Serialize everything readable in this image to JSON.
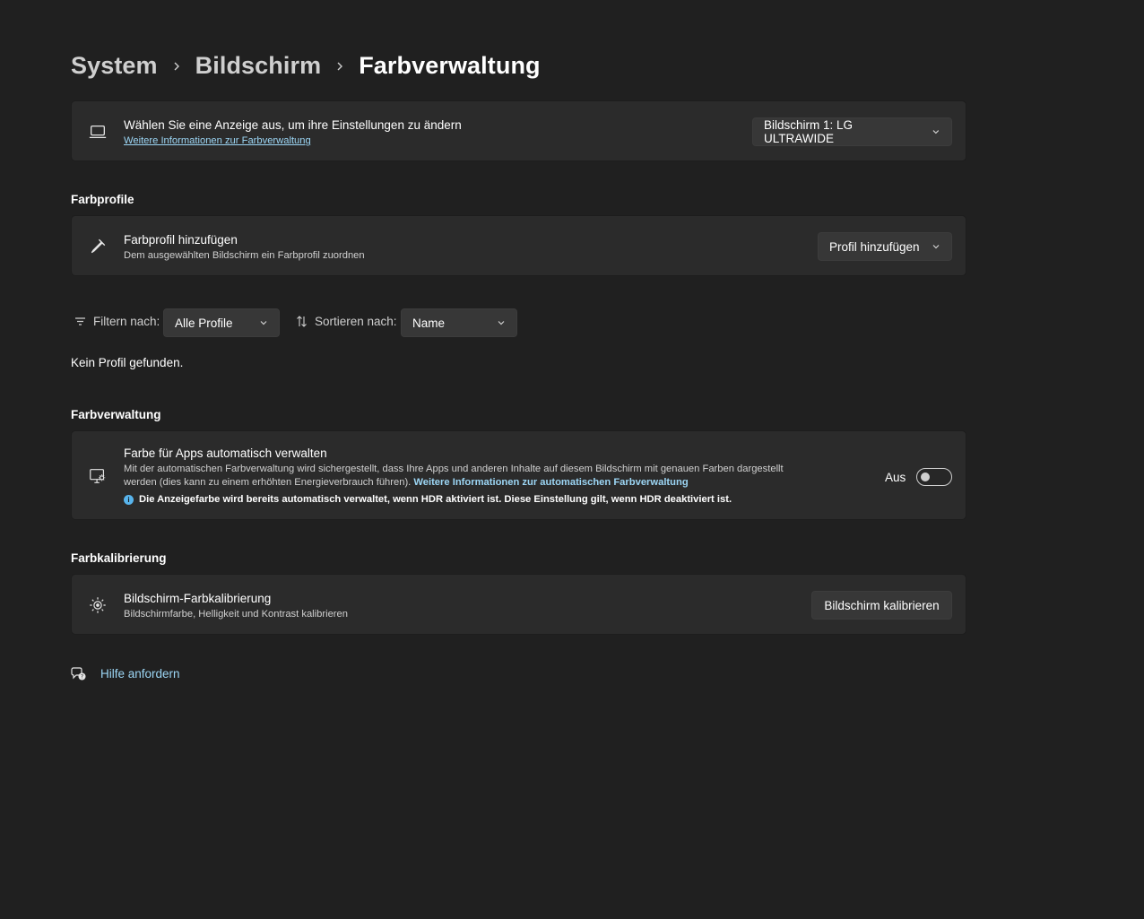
{
  "breadcrumb": {
    "level1": "System",
    "level2": "Bildschirm",
    "current": "Farbverwaltung"
  },
  "display_card": {
    "title": "Wählen Sie eine Anzeige aus, um ihre Einstellungen zu ändern",
    "link": "Weitere Informationen zur Farbverwaltung",
    "dropdown_value": "Bildschirm 1: LG ULTRAWIDE"
  },
  "profiles_section": {
    "title": "Farbprofile"
  },
  "add_profile_card": {
    "title": "Farbprofil hinzufügen",
    "subtitle": "Dem ausgewählten Bildschirm ein Farbprofil zuordnen",
    "dropdown_value": "Profil hinzufügen"
  },
  "filter": {
    "label": "Filtern nach:",
    "value": "Alle Profile"
  },
  "sort": {
    "label": "Sortieren nach:",
    "value": "Name"
  },
  "empty_message": "Kein Profil gefunden.",
  "management_section": {
    "title": "Farbverwaltung"
  },
  "auto_manage_card": {
    "title": "Farbe für Apps automatisch verwalten",
    "desc_line1": "Mit der automatischen Farbverwaltung wird sichergestellt, dass Ihre Apps und anderen Inhalte auf diesem Bildschirm mit genauen Farben dargestellt",
    "desc_line2": "werden (dies kann zu einem erhöhten Energieverbrauch führen).",
    "link": "Weitere Informationen zur automatischen Farbverwaltung",
    "info": "Die Anzeigefarbe wird bereits automatisch verwaltet, wenn HDR aktiviert ist. Diese Einstellung gilt, wenn HDR deaktiviert ist.",
    "toggle_label": "Aus",
    "toggle_on": false
  },
  "calibration_section": {
    "title": "Farbkalibrierung"
  },
  "calibration_card": {
    "title": "Bildschirm-Farbkalibrierung",
    "subtitle": "Bildschirmfarbe, Helligkeit und Kontrast kalibrieren",
    "button": "Bildschirm kalibrieren"
  },
  "help": {
    "label": "Hilfe anfordern"
  },
  "colors": {
    "background": "#202020",
    "card": "#2b2b2b",
    "link": "#9cd6f5",
    "accent_info": "#58b4ec"
  }
}
